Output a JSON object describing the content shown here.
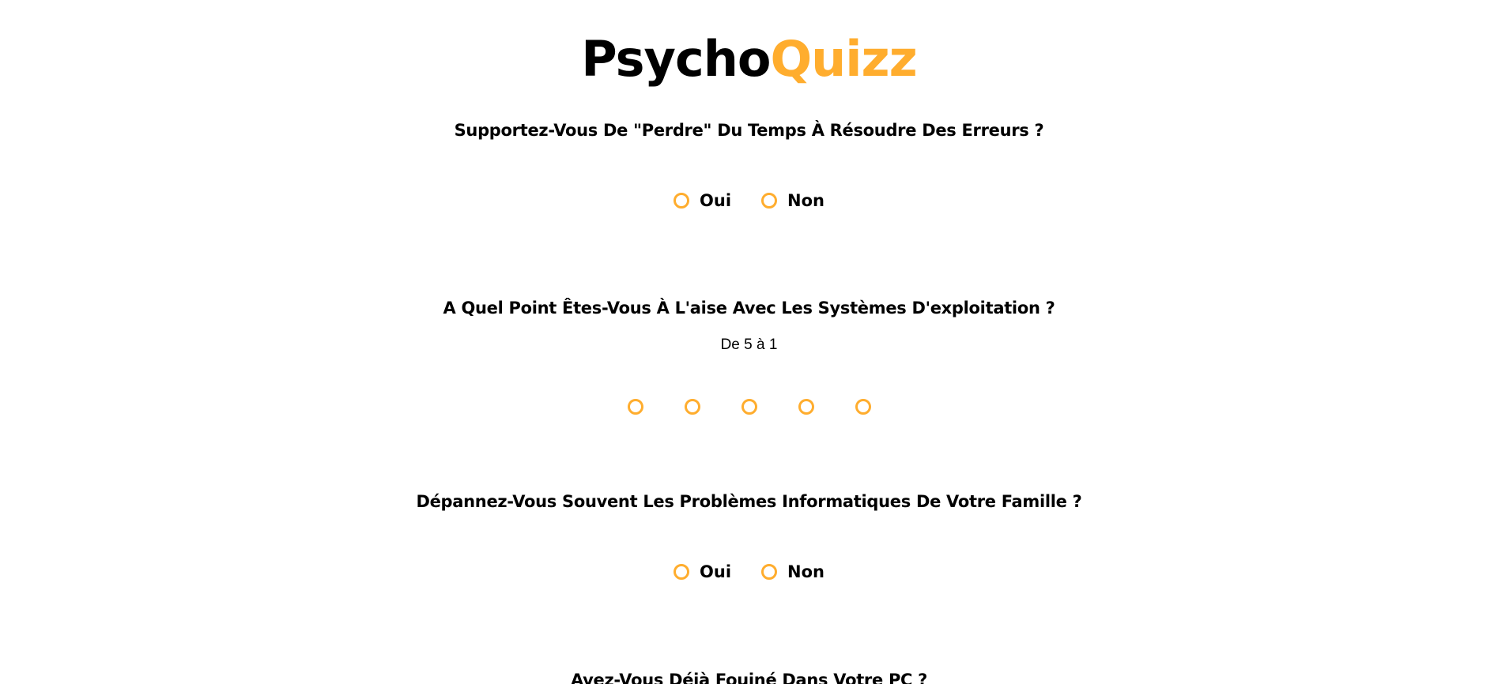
{
  "logo": {
    "part1": "Psycho",
    "part2": "Quizz"
  },
  "colors": {
    "accent": "#ffad2e",
    "text": "#000000",
    "background": "#ffffff"
  },
  "questions": [
    {
      "text": "Supportez-Vous De \"Perdre\" Du Temps À Résoudre Des Erreurs ?",
      "options": [
        "Oui",
        "Non"
      ]
    },
    {
      "text": "A Quel Point Êtes-Vous À L'aise Avec Les Systèmes D'exploitation ?",
      "hint": "De 5 à 1",
      "options": [
        "",
        "",
        "",
        "",
        ""
      ]
    },
    {
      "text": "Dépannez-Vous Souvent Les Problèmes Informatiques De Votre Famille ?",
      "options": [
        "Oui",
        "Non"
      ]
    },
    {
      "text": "Avez-Vous Déjà Fouiné Dans Votre PC ?"
    }
  ]
}
